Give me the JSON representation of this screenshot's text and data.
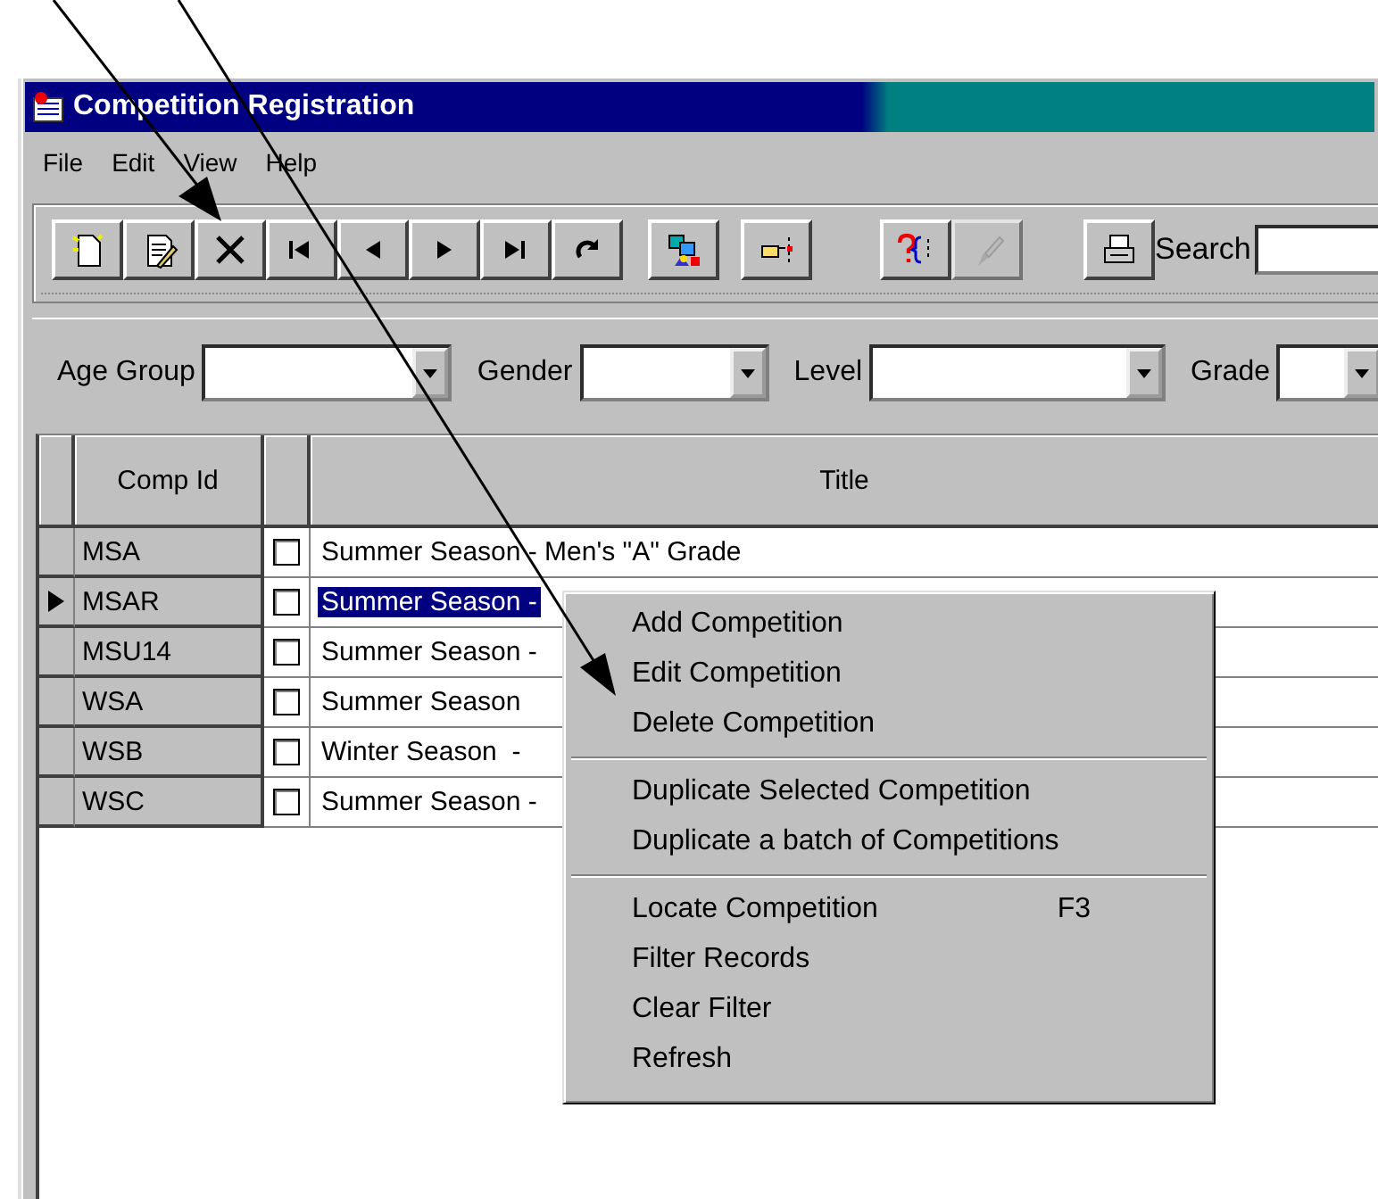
{
  "window": {
    "title": "Competition Registration"
  },
  "menu_bar": [
    "File",
    "Edit",
    "View",
    "Help"
  ],
  "toolbar": {
    "groups": [
      [
        {
          "kind": "new",
          "disabled": false
        },
        {
          "kind": "edit",
          "disabled": false
        },
        {
          "kind": "delete",
          "disabled": false
        },
        {
          "kind": "first",
          "disabled": false
        },
        {
          "kind": "prev",
          "disabled": false
        },
        {
          "kind": "next",
          "disabled": false
        },
        {
          "kind": "last",
          "disabled": false
        },
        {
          "kind": "redo",
          "disabled": false
        }
      ],
      [
        {
          "kind": "network",
          "disabled": false
        }
      ],
      [
        {
          "kind": "pointer",
          "disabled": false
        }
      ],
      [
        {
          "kind": "help",
          "disabled": false
        },
        {
          "kind": "brush",
          "disabled": true
        }
      ],
      [
        {
          "kind": "print",
          "disabled": false
        }
      ]
    ],
    "search": {
      "label": "Search"
    }
  },
  "filters": [
    {
      "label": "Age Group"
    },
    {
      "label": "Gender"
    },
    {
      "label": "Level"
    },
    {
      "label": "Grade"
    }
  ],
  "grid": {
    "columns": [
      "Comp Id",
      "Title"
    ],
    "rows": [
      {
        "comp_id": "MSA",
        "checked": false,
        "title": "Summer Season - Men's \"A\" Grade",
        "selected": false
      },
      {
        "comp_id": "MSAR",
        "checked": false,
        "title": "Summer Season -",
        "selected": true
      },
      {
        "comp_id": "MSU14",
        "checked": false,
        "title": "Summer Season -",
        "selected": false
      },
      {
        "comp_id": "WSA",
        "checked": false,
        "title": "Summer Season",
        "selected": false
      },
      {
        "comp_id": "WSB",
        "checked": false,
        "title": "Winter Season  -",
        "selected": false
      },
      {
        "comp_id": "WSC",
        "checked": false,
        "title": "Summer Season -",
        "selected": false
      }
    ]
  },
  "context_menu": {
    "sections": [
      [
        {
          "label": "Add Competition"
        },
        {
          "label": "Edit Competition"
        },
        {
          "label": "Delete Competition"
        }
      ],
      [
        {
          "label": "Duplicate Selected Competition"
        },
        {
          "label": "Duplicate a batch of Competitions"
        }
      ],
      [
        {
          "label": "Locate Competition",
          "shortcut": "F3"
        },
        {
          "label": "Filter Records"
        },
        {
          "label": "Clear Filter"
        },
        {
          "label": "Refresh"
        }
      ]
    ]
  }
}
